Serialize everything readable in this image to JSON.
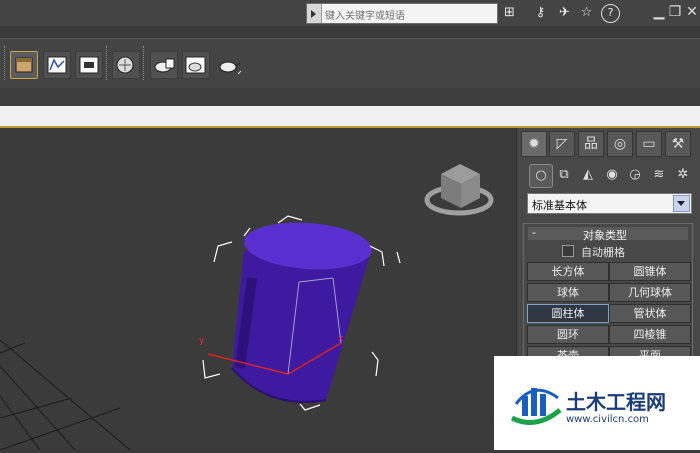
{
  "search": {
    "placeholder": "键入关键字或短语"
  },
  "top_icons": [
    "binoculars-icon",
    "key-icon",
    "satellite-icon",
    "star-icon",
    "help-icon"
  ],
  "toolbar": {
    "icons": [
      "scene-explorer-icon",
      "curve-editor-icon",
      "render-setup-icon",
      "material-editor-icon",
      "render-frame-icon",
      "render-icon",
      "quick-render-icon"
    ]
  },
  "panel": {
    "tabs": [
      "create-tab",
      "modify-tab",
      "hierarchy-tab",
      "motion-tab",
      "display-tab",
      "utilities-tab"
    ],
    "category": "标准基本体",
    "rollout": {
      "title": "对象类型",
      "autogrid_label": "自动栅格",
      "buttons": [
        "长方体",
        "圆锥体",
        "球体",
        "几何球体",
        "圆柱体",
        "管状体",
        "圆环",
        "四棱锥",
        "茶壶",
        "平面"
      ],
      "selected": "圆柱体"
    }
  },
  "viewport": {
    "axis_x": "x",
    "axis_y": "y"
  },
  "colors": {
    "cylinder": "#3d1aa0",
    "cylinder_top": "#5a2fd0",
    "accent": "#b89a3a"
  },
  "watermark": {
    "title": "土木工程网",
    "url": "www.civilcn.com"
  }
}
